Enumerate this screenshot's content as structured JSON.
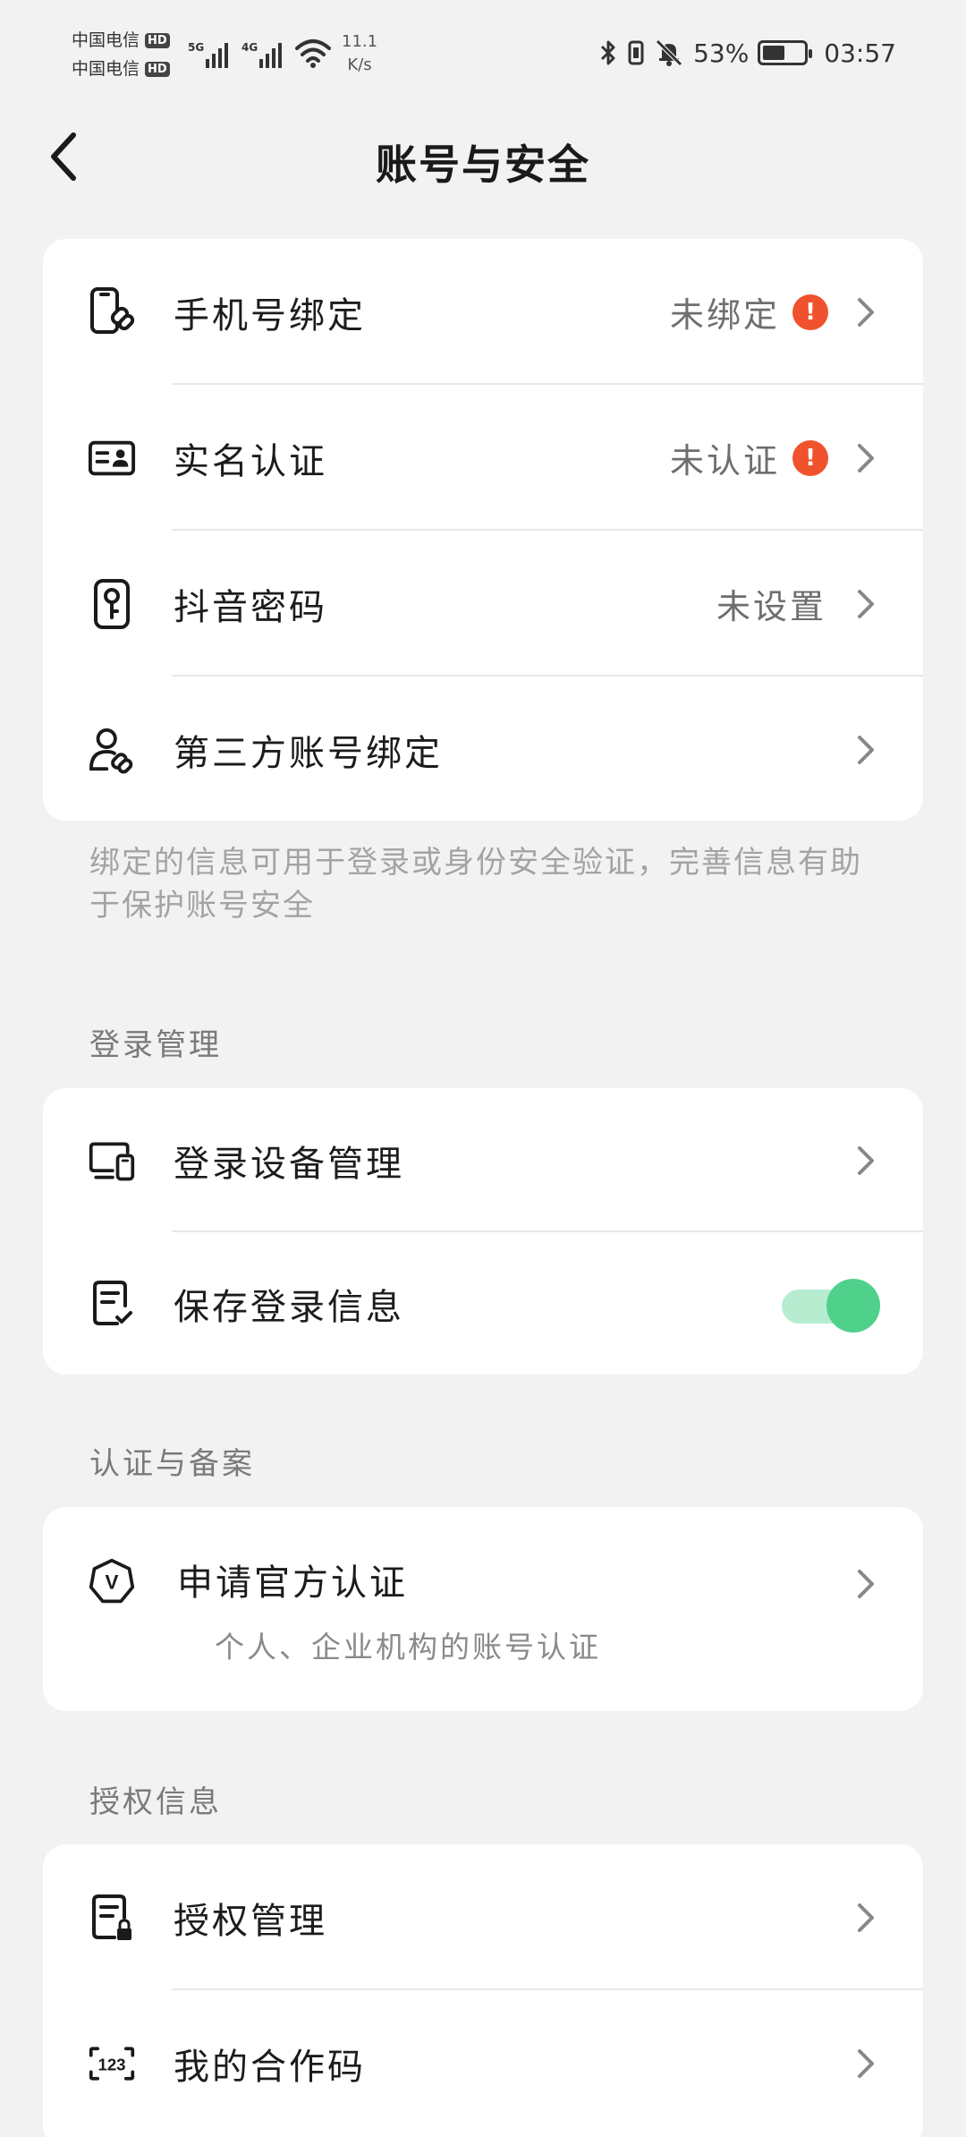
{
  "status_bar": {
    "carrier1": "中国电信",
    "carrier2": "中国电信",
    "hd_badge": "HD",
    "sim1_net": "5G",
    "sim2_net": "4G",
    "speed_value": "11.1",
    "speed_unit": "K/s",
    "battery_percent": "53%",
    "battery_level": 0.53,
    "time": "03:57"
  },
  "header": {
    "title": "账号与安全"
  },
  "account_card": {
    "items": [
      {
        "label": "手机号绑定",
        "value": "未绑定",
        "warning": "!"
      },
      {
        "label": "实名认证",
        "value": "未认证",
        "warning": "!"
      },
      {
        "label": "抖音密码",
        "value": "未设置"
      },
      {
        "label": "第三方账号绑定"
      }
    ]
  },
  "account_note": "绑定的信息可用于登录或身份安全验证，完善信息有助于保护账号安全",
  "login_section": {
    "title": "登录管理",
    "items": [
      {
        "label": "登录设备管理"
      },
      {
        "label": "保存登录信息",
        "toggle_on": true
      }
    ]
  },
  "verify_section": {
    "title": "认证与备案",
    "item": {
      "label": "申请官方认证",
      "sublabel": "个人、企业机构的账号认证",
      "icon_letter": "V"
    }
  },
  "auth_section": {
    "title": "授权信息",
    "items": [
      {
        "label": "授权管理"
      },
      {
        "label": "我的合作码",
        "icon_text": "123"
      }
    ]
  },
  "colors": {
    "background": "#f2f2f2",
    "card": "#ffffff",
    "warning": "#f0522d",
    "toggle_on": "#4fd18b",
    "toggle_track": "#b7ecd0"
  }
}
